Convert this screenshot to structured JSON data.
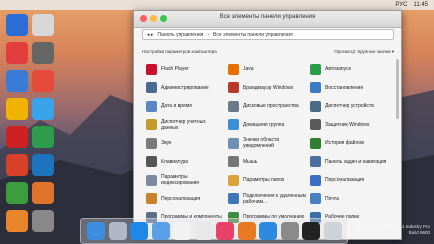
{
  "menubar": {
    "lang": "РУС",
    "time": "11:45"
  },
  "desktop": {
    "icons": [
      {
        "label": "",
        "color": "#2b6cd6"
      },
      {
        "label": "",
        "color": "#d8d8d8"
      },
      {
        "label": "",
        "color": "#e23c3c"
      },
      {
        "label": "",
        "color": "#666"
      },
      {
        "label": "",
        "color": "#3a7bd5"
      },
      {
        "label": "",
        "color": "#e64a3b"
      },
      {
        "label": "",
        "color": "#f0b400"
      },
      {
        "label": "",
        "color": "#38a3e8"
      },
      {
        "label": "",
        "color": "#cc2222"
      },
      {
        "label": "",
        "color": "#2d9c4d"
      },
      {
        "label": "",
        "color": "#d8402a"
      },
      {
        "label": "",
        "color": "#1e73be"
      },
      {
        "label": "",
        "color": "#3b9d3b"
      },
      {
        "label": "",
        "color": "#e0742b"
      },
      {
        "label": "",
        "color": "#e8852b"
      },
      {
        "label": "",
        "color": "#888"
      }
    ]
  },
  "window": {
    "title": "Все элементы панели управления",
    "address": [
      "Панель управления",
      "Все элементы панели управления"
    ],
    "subtitle": "Настройка параметров компьютера",
    "view_label": "Просмотр:",
    "view_value": "Крупные значки ▾",
    "items": [
      {
        "label": "Flash Player",
        "color": "#c8102e"
      },
      {
        "label": "Java",
        "color": "#e76f00"
      },
      {
        "label": "Автозапуск",
        "color": "#2a9d4a"
      },
      {
        "label": "Администрирование",
        "color": "#4b6a8f"
      },
      {
        "label": "Брандмауэр Windows",
        "color": "#b43b2a"
      },
      {
        "label": "Восстановление",
        "color": "#3c7bc4"
      },
      {
        "label": "Дата и время",
        "color": "#5b86c5"
      },
      {
        "label": "Дисковые пространства",
        "color": "#6b7a8a"
      },
      {
        "label": "Диспетчер устройств",
        "color": "#4a6b86"
      },
      {
        "label": "Диспетчер учетных данных",
        "color": "#c79b2a"
      },
      {
        "label": "Домашняя группа",
        "color": "#3a8fd8"
      },
      {
        "label": "Защитник Windows",
        "color": "#5a5a5a"
      },
      {
        "label": "Звук",
        "color": "#7a7a7a"
      },
      {
        "label": "Значки области уведомлений",
        "color": "#6e8fb5"
      },
      {
        "label": "История файлов",
        "color": "#2e7d32"
      },
      {
        "label": "Клавиатура",
        "color": "#555"
      },
      {
        "label": "Мышь",
        "color": "#777"
      },
      {
        "label": "Панель задач и навигация",
        "color": "#4d6f9e"
      },
      {
        "label": "Параметры индексирования",
        "color": "#7c8aa0"
      },
      {
        "label": "Параметры папок",
        "color": "#d9a53b"
      },
      {
        "label": "Персонализация",
        "color": "#3a6fc2"
      },
      {
        "label": "Персонализация",
        "color": "#c9832a"
      },
      {
        "label": "Подключения к удаленным рабочим...",
        "color": "#3d77b8"
      },
      {
        "label": "Почта",
        "color": "#4a7fc1"
      },
      {
        "label": "Программы и компоненты",
        "color": "#5b6f8b"
      },
      {
        "label": "Программы по умолчанию",
        "color": "#3f8d3f"
      },
      {
        "label": "Рабочие папки",
        "color": "#3b6ea8"
      }
    ]
  },
  "dock": {
    "items": [
      {
        "name": "finder",
        "color": "#3d8ee0"
      },
      {
        "name": "launchpad",
        "color": "#b0b8c8"
      },
      {
        "name": "safari",
        "color": "#1f87e6"
      },
      {
        "name": "mail",
        "color": "#5aa0e8"
      },
      {
        "name": "calendar",
        "color": "#f2f2f2"
      },
      {
        "name": "photos",
        "color": "#e8e8e8"
      },
      {
        "name": "itunes",
        "color": "#e8416a"
      },
      {
        "name": "ibooks",
        "color": "#e67a22"
      },
      {
        "name": "app-store",
        "color": "#2e8ae0"
      },
      {
        "name": "settings",
        "color": "#8a8a8a"
      },
      {
        "name": "terminal",
        "color": "#222"
      },
      {
        "name": "trash",
        "color": "#cfd3d8"
      }
    ]
  },
  "watermark": {
    "line1": "Windows Embedded 8.1 Industry Pro",
    "line2": "Build 9600"
  }
}
